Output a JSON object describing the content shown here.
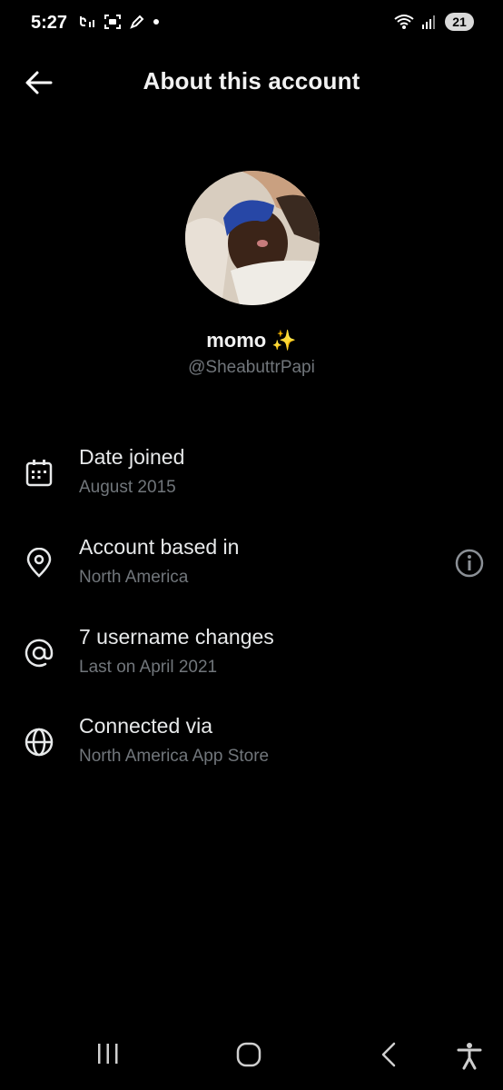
{
  "status_bar": {
    "time": "5:27",
    "battery": "21",
    "left_icons": [
      "call-forward-icon",
      "screenshot-icon",
      "pen-icon",
      "dot-icon"
    ],
    "right_icons": [
      "wifi-icon",
      "signal-icon"
    ]
  },
  "header": {
    "title": "About this account",
    "back_icon": "arrow-left-icon"
  },
  "profile": {
    "display_name": "momo ✨",
    "handle": "@SheabuttrPapi"
  },
  "info_rows": [
    {
      "icon": "calendar-icon",
      "title": "Date joined",
      "subtitle": "August 2015"
    },
    {
      "icon": "location-pin-icon",
      "title": "Account based in",
      "subtitle": "North America",
      "action_icon": "info-icon"
    },
    {
      "icon": "at-sign-icon",
      "title": "7 username changes",
      "subtitle": "Last on April 2021"
    },
    {
      "icon": "globe-icon",
      "title": "Connected via",
      "subtitle": "North America App Store"
    }
  ],
  "nav_bar": {
    "buttons": [
      "recents-icon",
      "home-icon",
      "back-icon",
      "accessibility-icon"
    ]
  },
  "colors": {
    "background": "#000000",
    "primary_text": "#e7e9ea",
    "secondary_text": "#71767b"
  }
}
